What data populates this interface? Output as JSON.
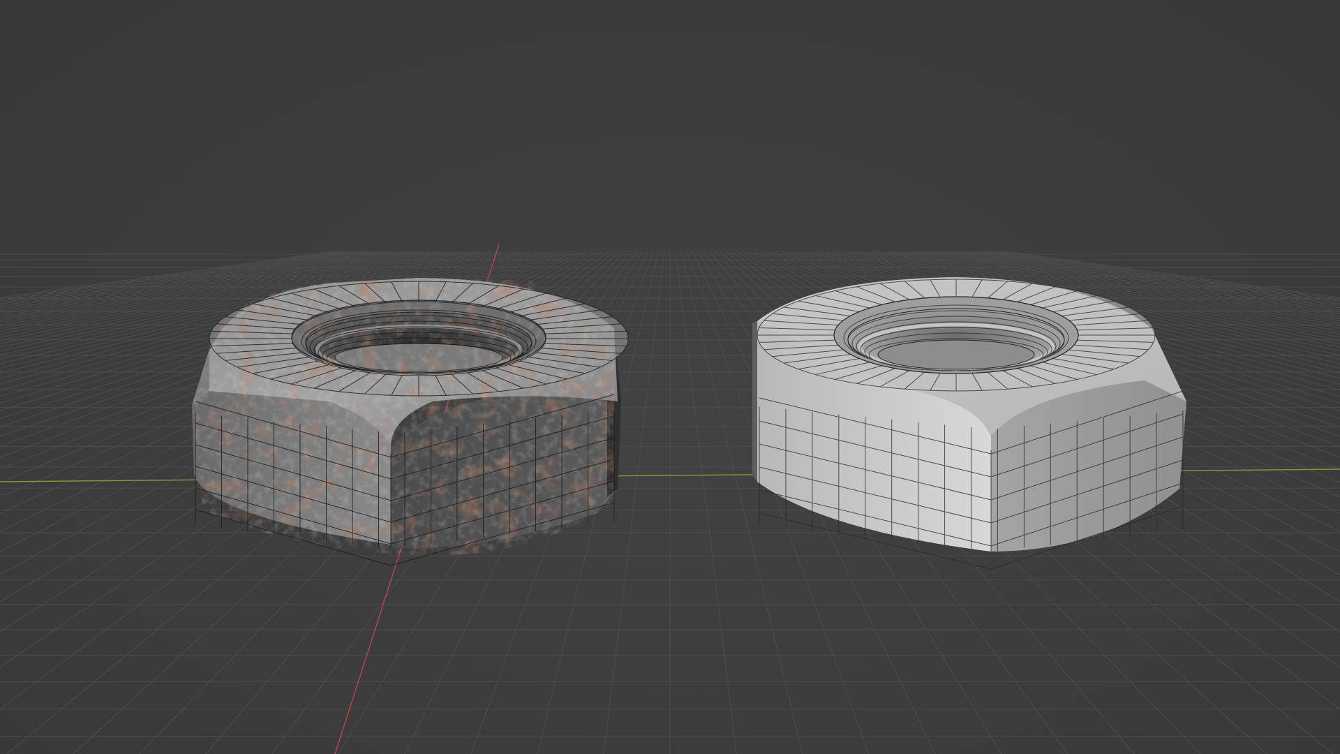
{
  "viewport": {
    "background": "#3d3d3d",
    "grid_color": "#4d4d4d",
    "axis_x_color": "#7a9a3e",
    "axis_y_color": "#b04848",
    "show_floor_grid": true
  },
  "objects": [
    {
      "name": "hex-nut-textured",
      "shading": "material-preview",
      "material": "rusted-steel",
      "wireframe_overlay": true
    },
    {
      "name": "hex-nut-solid",
      "shading": "solid",
      "material": "clay-white",
      "wireframe_overlay": true
    }
  ]
}
